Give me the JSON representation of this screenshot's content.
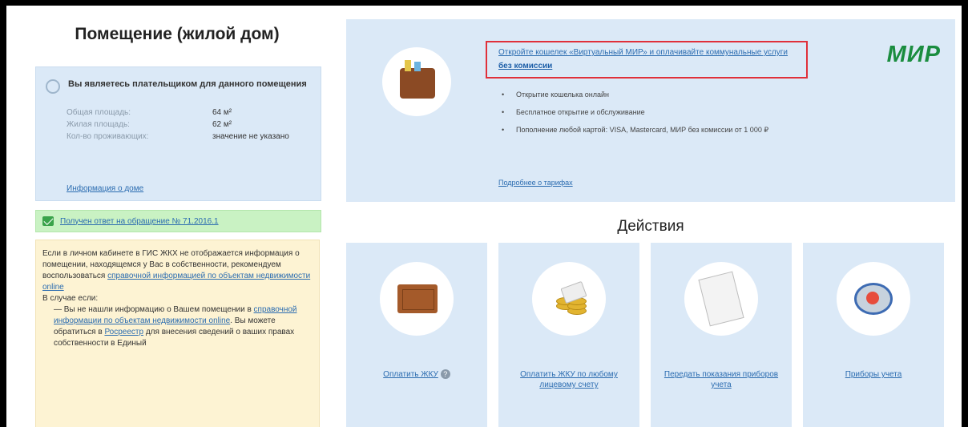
{
  "left": {
    "room_title": "Помещение (жилой дом)",
    "payer": {
      "title": "Вы являетесь плательщиком для данного помещения",
      "rows": [
        {
          "key": "Общая площадь:",
          "value": "64 м²"
        },
        {
          "key": "Жилая площадь:",
          "value": "62 м²"
        },
        {
          "key": "Кол-во проживающих:",
          "value": "значение не указано"
        }
      ],
      "house_link": "Информация о доме"
    },
    "answer_link": "Получен ответ на обращение № 71.2016.1",
    "note": {
      "p1_start": "Если в личном кабинете в ГИС ЖКХ не отображается информация о помещении, находящемся у Вас в собственности, рекомендуем воспользоваться ",
      "p1_link": "справочной информацией по объектам недвижимости online",
      "p2": "В случае если:",
      "p3_start": "— Вы не нашли информацию о Вашем помещении в ",
      "p3_link1": "справочной информации по объектам недвижимости online",
      "p3_mid": ". Вы можете обратиться в ",
      "p3_link2": "Росреестр",
      "p3_end": " для внесения сведений о ваших правах собственности в Единый"
    }
  },
  "promo": {
    "link_text": "Откройте кошелек «Виртуальный МИР» и оплачивайте коммунальные услуги",
    "link_bold": "без комиссии",
    "logo_text": "МИР",
    "bullets": [
      "Открытие кошелька онлайн",
      "Бесплатное открытие и обслуживание",
      "Пополнение любой картой: VISA, Mastercard, МИР без комиссии от 1 000 ₽"
    ],
    "tariff_link": "Подробнее о тарифах"
  },
  "actions": {
    "title": "Действия",
    "cards": [
      {
        "label": "Оплатить ЖКУ",
        "help": "?"
      },
      {
        "label": "Оплатить ЖКУ по любому лицевому счету"
      },
      {
        "label": "Передать показания приборов учета"
      },
      {
        "label": "Приборы учета"
      }
    ]
  }
}
